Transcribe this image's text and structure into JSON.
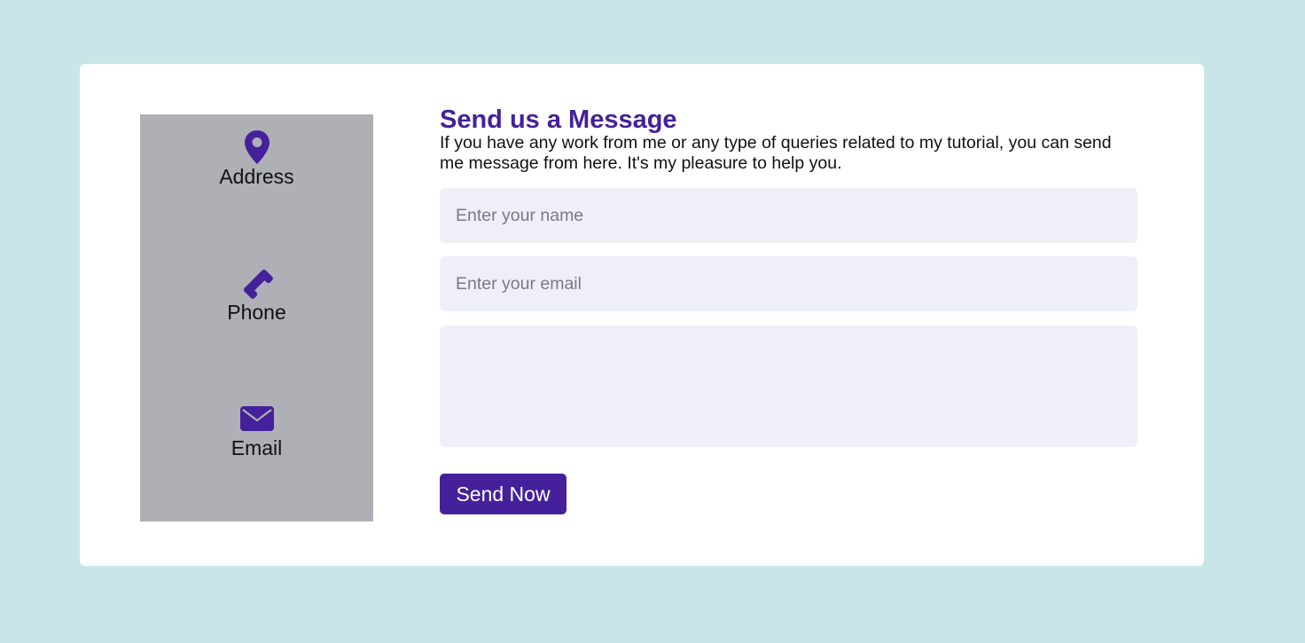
{
  "contact_info": {
    "items": [
      {
        "icon": "map-pin-icon",
        "label": "Address"
      },
      {
        "icon": "phone-icon",
        "label": "Phone"
      },
      {
        "icon": "envelope-icon",
        "label": "Email"
      }
    ]
  },
  "form": {
    "title": "Send us a Message",
    "description": "If you have any work from me or any type of queries related to my tutorial, you can send me message from here. It's my pleasure to help you.",
    "name_placeholder": "Enter your name",
    "email_placeholder": "Enter your email",
    "message_placeholder": "",
    "submit_label": "Send Now"
  },
  "colors": {
    "background": "#c8e6e8",
    "card": "#ffffff",
    "info_panel": "#afb0b5",
    "accent": "#44219a",
    "input_bg": "#efeff7"
  }
}
